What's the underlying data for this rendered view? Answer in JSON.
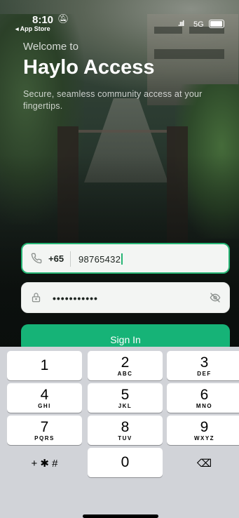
{
  "status_bar": {
    "time": "8:10",
    "back_app": "◂ App Store",
    "signal": ".ııl",
    "network": "5G"
  },
  "hero": {
    "welcome": "Welcome to",
    "title": "Haylo Access",
    "subtitle": "Secure, seamless community access at your fingertips."
  },
  "phone": {
    "country_code": "+65",
    "value": "98765432",
    "icon": "phone-icon"
  },
  "password": {
    "value": "•••••••••••",
    "icon": "lock-icon",
    "toggle_icon": "eye-off-icon"
  },
  "signin_label": "Sign In",
  "keyboard": {
    "keys": [
      {
        "num": "1",
        "letters": ""
      },
      {
        "num": "2",
        "letters": "ABC"
      },
      {
        "num": "3",
        "letters": "DEF"
      },
      {
        "num": "4",
        "letters": "GHI"
      },
      {
        "num": "5",
        "letters": "JKL"
      },
      {
        "num": "6",
        "letters": "MNO"
      },
      {
        "num": "7",
        "letters": "PQRS"
      },
      {
        "num": "8",
        "letters": "TUV"
      },
      {
        "num": "9",
        "letters": "WXYZ"
      },
      {
        "num": "+ ✱ #",
        "letters": ""
      },
      {
        "num": "0",
        "letters": ""
      },
      {
        "num": "⌫",
        "letters": ""
      }
    ]
  },
  "colors": {
    "accent": "#16b377",
    "focus_border": "#26b574",
    "keyboard_bg": "#d1d3d8"
  }
}
